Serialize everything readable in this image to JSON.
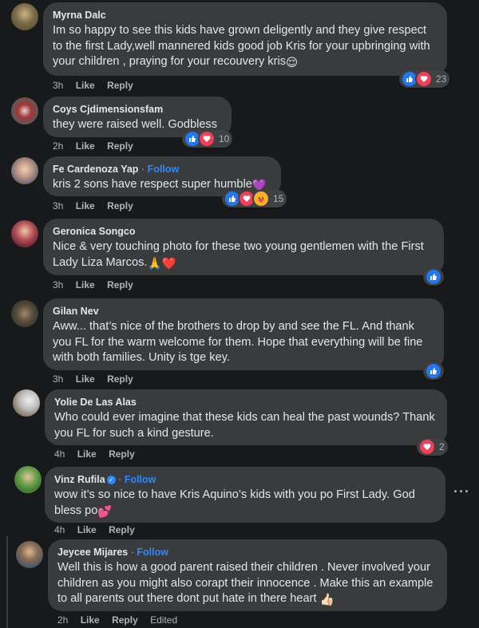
{
  "comments": [
    {
      "name": "Myrna Dalc",
      "follow": "",
      "text": "Im so happy to see this kids have grown deligently and they give respect to the first Lady,well mannered kids good job Kris for your upbringing with your children , praying for your recouvery kris",
      "emoji": "😌",
      "time": "3h",
      "like": "Like",
      "reply": "Reply",
      "reaction_count": "23",
      "reactions": [
        "like-icon",
        "love-icon"
      ]
    },
    {
      "name": "Coys Cjdimensionsfam",
      "follow": "",
      "text": "they were raised well. Godbless",
      "emoji": "",
      "time": "2h",
      "like": "Like",
      "reply": "Reply",
      "reaction_count": "10",
      "reactions": [
        "like-icon",
        "love-icon"
      ]
    },
    {
      "name": "Fe Cardenoza Yap",
      "follow": "Follow",
      "text": "kris 2 sons have respect super humble",
      "emoji": "💜",
      "time": "3h",
      "like": "Like",
      "reply": "Reply",
      "reaction_count": "15",
      "reactions": [
        "like-icon",
        "love-icon",
        "care-icon"
      ]
    },
    {
      "name": "Geronica Songco",
      "follow": "",
      "text": "Nice & very touching photo for these two young gentlemen with the First Lady Liza Marcos.",
      "emoji": "🙏❤️",
      "time": "3h",
      "like": "Like",
      "reply": "Reply",
      "reaction_count": "",
      "reactions": [
        "like-icon"
      ]
    },
    {
      "name": "Gilan Nev",
      "follow": "",
      "text": "Aww... that’s nice of the brothers to drop by and see the FL. And thank you FL for the warm welcome for them. Hope that everything will be fine with both families. Unity is tge key.",
      "emoji": "",
      "time": "3h",
      "like": "Like",
      "reply": "Reply",
      "reaction_count": "",
      "reactions": [
        "like-icon"
      ]
    },
    {
      "name": "Yolie De Las Alas",
      "follow": "",
      "text": "Who could ever imagine that these kids can heal the past wounds? Thank you FL for such a kind gesture.",
      "emoji": "",
      "time": "4h",
      "like": "Like",
      "reply": "Reply",
      "reaction_count": "2",
      "reactions": [
        "love-icon"
      ]
    },
    {
      "name": "Vinz Rufila",
      "follow": "Follow",
      "text": "wow it’s so nice to have Kris Aquino’s kids with you po First Lady. God bless po",
      "emoji": "💕",
      "time": "4h",
      "like": "Like",
      "reply": "Reply",
      "reaction_count": "",
      "reactions": []
    },
    {
      "name": "Jeycee Mijares",
      "follow": "Follow",
      "text": "Well this is how a good parent raised their children . Never involved your children as you might also corapt their innocence . Make this an example to all parents out there dont put hate in there heart",
      "emoji": "👍🏻",
      "time": "2h",
      "like": "Like",
      "reply": "Reply",
      "edited": "Edited",
      "reaction_count": "",
      "reactions": []
    }
  ],
  "more_options": "···",
  "dot_separator": "·",
  "colors": {
    "background": "#18191a",
    "bubble": "#3a3b3c",
    "text": "#e4e6eb",
    "meta": "#b0b3b8",
    "follow": "#2d88ff",
    "like": "#2078f4",
    "love": "#f33e58",
    "care": "#f7b125"
  }
}
